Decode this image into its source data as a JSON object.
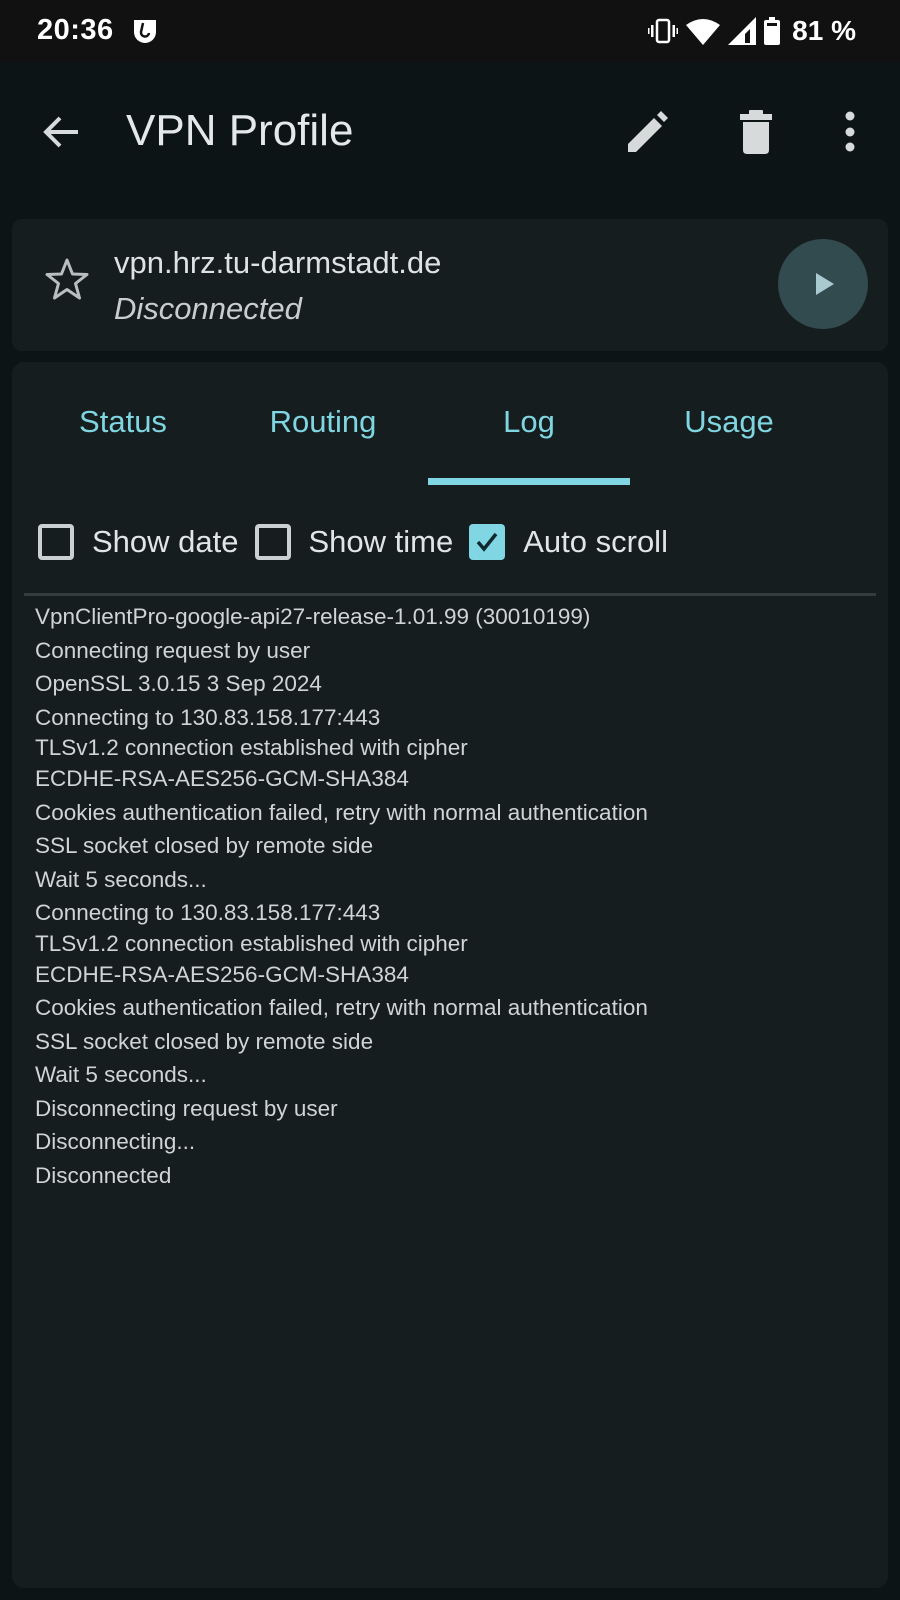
{
  "status_bar": {
    "time": "20:36",
    "app_notification_icon": "shield-app-icon",
    "icons": [
      "vibrate-icon",
      "wifi-icon",
      "cellular-signal-icon",
      "battery-icon"
    ],
    "battery": "81 %"
  },
  "app_bar": {
    "title": "VPN Profile",
    "back_icon": "arrow-back-icon",
    "actions": [
      "edit-icon",
      "delete-icon",
      "more-vert-icon"
    ]
  },
  "profile": {
    "name": "vpn.hrz.tu-darmstadt.de",
    "status": "Disconnected",
    "favorite": false,
    "connect_icon": "play-icon"
  },
  "tabs": {
    "items": [
      {
        "label": "Status"
      },
      {
        "label": "Routing"
      },
      {
        "label": "Log"
      },
      {
        "label": "Usage"
      }
    ],
    "active": "Log"
  },
  "options": [
    {
      "label": "Show date",
      "checked": false
    },
    {
      "label": "Show time",
      "checked": false
    },
    {
      "label": "Auto scroll",
      "checked": true
    }
  ],
  "log": [
    "VpnClientPro-google-api27-release-1.01.99 (30010199)",
    "Connecting request by user",
    "OpenSSL 3.0.15 3 Sep 2024",
    "Connecting to 130.83.158.177:443",
    "TLSv1.2 connection established with cipher\nECDHE-RSA-AES256-GCM-SHA384",
    "Cookies authentication failed, retry with normal authentication",
    "SSL socket closed by remote side",
    "Wait 5 seconds...",
    "Connecting to 130.83.158.177:443",
    "TLSv1.2 connection established with cipher\nECDHE-RSA-AES256-GCM-SHA384",
    "Cookies authentication failed, retry with normal authentication",
    "SSL socket closed by remote side",
    "Wait 5 seconds...",
    "Disconnecting request by user",
    "Disconnecting...",
    "Disconnected"
  ],
  "colors": {
    "accent": "#80d6e2",
    "background": "#0d1416",
    "surface": "#161d1f",
    "connect_button": "#314b4f"
  }
}
